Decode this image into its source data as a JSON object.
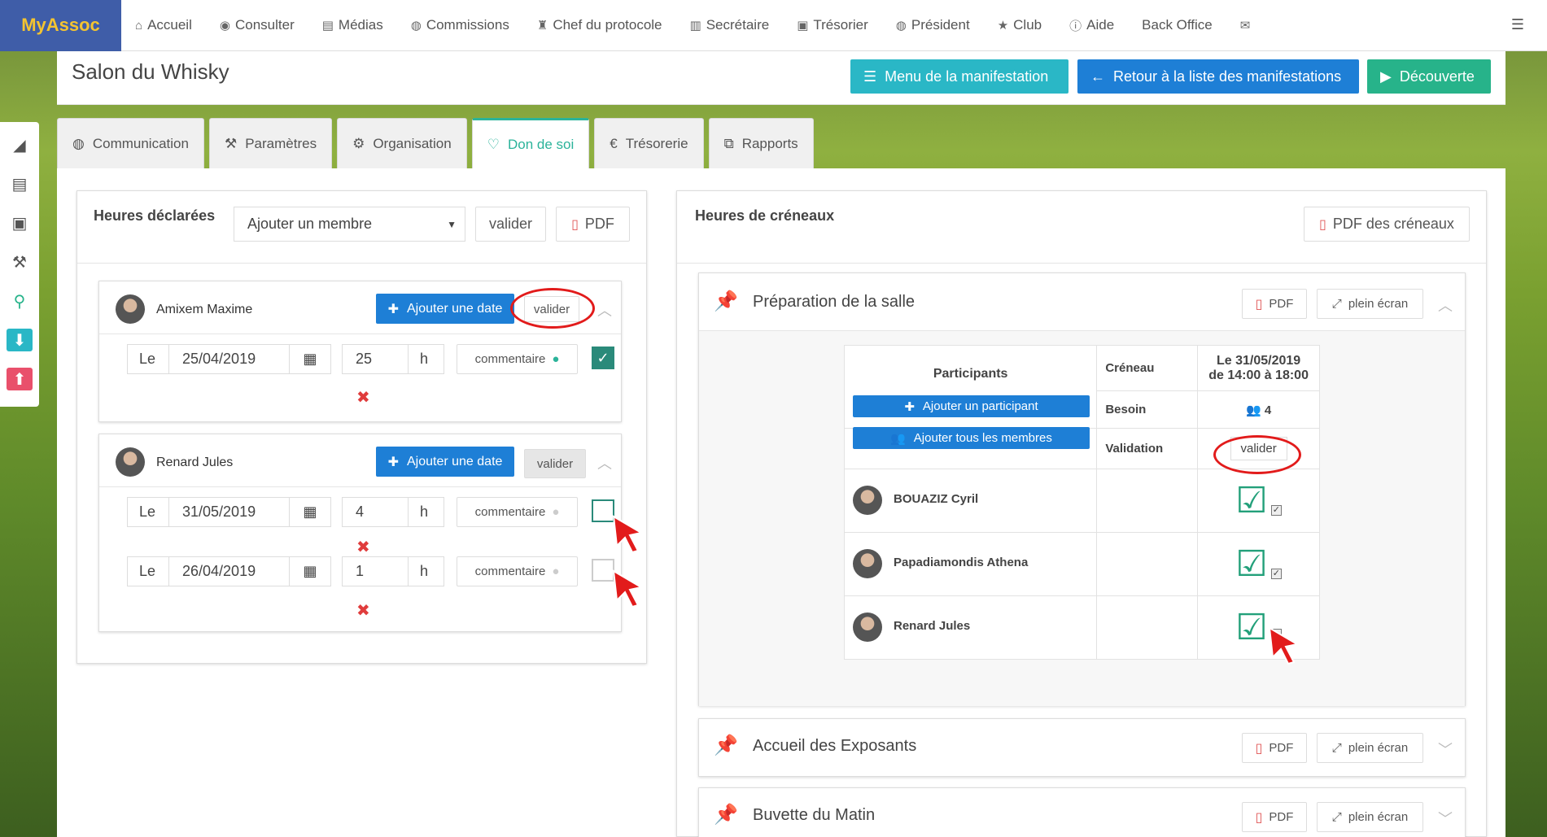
{
  "app": {
    "brand": "MyAssoc"
  },
  "nav": {
    "items": [
      {
        "label": "Accueil",
        "icon": "home-icon"
      },
      {
        "label": "Consulter",
        "icon": "eye-icon"
      },
      {
        "label": "Médias",
        "icon": "file-icon"
      },
      {
        "label": "Commissions",
        "icon": "globe-icon"
      },
      {
        "label": "Chef du protocole",
        "icon": "trophy-icon"
      },
      {
        "label": "Secrétaire",
        "icon": "book-icon"
      },
      {
        "label": "Trésorier",
        "icon": "money-icon"
      },
      {
        "label": "Président",
        "icon": "globe-icon"
      },
      {
        "label": "Club",
        "icon": "star-icon"
      },
      {
        "label": "Aide",
        "icon": "info-icon"
      },
      {
        "label": "Back Office",
        "icon": ""
      }
    ]
  },
  "header": {
    "title": "Salon du Whisky",
    "btn_menu": "Menu de la manifestation",
    "btn_back": "Retour à la liste des manifestations",
    "btn_discover": "Découverte",
    "colors": {
      "teal": "#2ab7c6",
      "blue": "#1e7fd6",
      "green": "#27b38a"
    }
  },
  "tabs": [
    {
      "label": "Communication",
      "icon": "globe-icon",
      "active": false
    },
    {
      "label": "Paramètres",
      "icon": "wrench-icon",
      "active": false
    },
    {
      "label": "Organisation",
      "icon": "gears-icon",
      "active": false
    },
    {
      "label": "Don de soi",
      "icon": "heart-icon",
      "active": true
    },
    {
      "label": "Trésorerie",
      "icon": "euro-icon",
      "active": false
    },
    {
      "label": "Rapports",
      "icon": "copy-icon",
      "active": false
    }
  ],
  "left_panel": {
    "title": "Heures déclarées",
    "select_value": "Ajouter un membre",
    "validate": "valider",
    "pdf": "PDF",
    "members": [
      {
        "name": "Amixem Maxime",
        "add_date": "Ajouter une date",
        "validate": "valider",
        "entries": [
          {
            "le": "Le",
            "date": "25/04/2019",
            "hours": "25",
            "unit": "h",
            "comment": "commentaire",
            "checked": true
          }
        ]
      },
      {
        "name": "Renard Jules",
        "add_date": "Ajouter une date",
        "validate": "valider",
        "entries": [
          {
            "le": "Le",
            "date": "31/05/2019",
            "hours": "4",
            "unit": "h",
            "comment": "commentaire",
            "checked": false
          },
          {
            "le": "Le",
            "date": "26/04/2019",
            "hours": "1",
            "unit": "h",
            "comment": "commentaire",
            "checked": false
          }
        ]
      }
    ]
  },
  "right_panel": {
    "title": "Heures de créneaux",
    "pdf_slots": "PDF des créneaux",
    "sections": [
      {
        "title": "Préparation de la salle",
        "pdf": "PDF",
        "fullscreen": "plein écran"
      },
      {
        "title": "Accueil des Exposants",
        "pdf": "PDF",
        "fullscreen": "plein écran"
      },
      {
        "title": "Buvette du Matin",
        "pdf": "PDF",
        "fullscreen": "plein écran"
      }
    ],
    "table": {
      "participants": "Participants",
      "add_participant": "Ajouter un participant",
      "add_all": "Ajouter tous les membres",
      "creneau": "Créneau",
      "creneau_value_1": "Le 31/05/2019",
      "creneau_value_2": "de 14:00 à 18:00",
      "besoin": "Besoin",
      "besoin_value": "4",
      "validation": "Validation",
      "validate": "valider",
      "rows": [
        {
          "name": "BOUAZIZ Cyril",
          "checked": true
        },
        {
          "name": "Papadiamondis Athena",
          "checked": true
        },
        {
          "name": "Renard Jules",
          "checked": false
        }
      ]
    }
  }
}
